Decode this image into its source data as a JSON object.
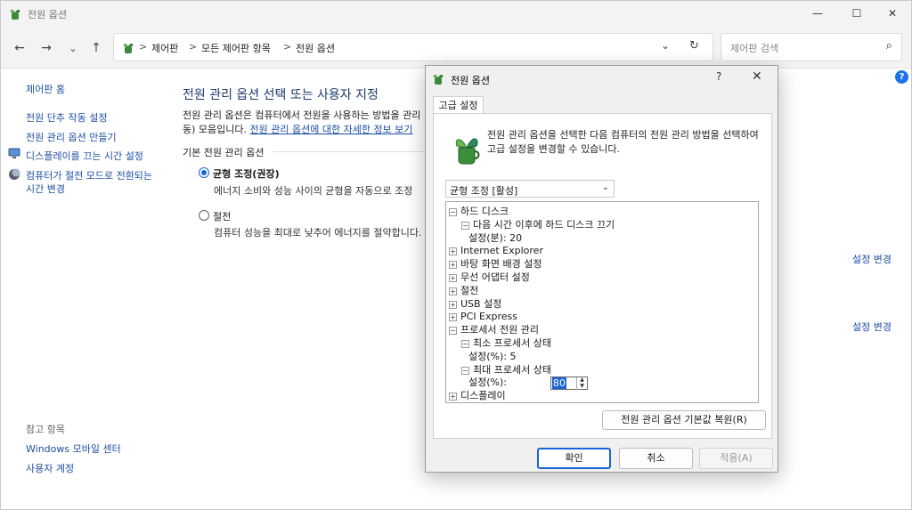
{
  "window": {
    "title": "전원 옵션",
    "controls": {
      "minimize": "—",
      "maximize": "☐",
      "close": "✕"
    }
  },
  "nav": {
    "back": "←",
    "forward": "→",
    "recent": "⌄",
    "up": "↑",
    "breadcrumb": [
      "제어판",
      "모든 제어판 항목",
      "전원 옵션"
    ],
    "separator": ">",
    "dropdown": "⌄",
    "refresh": "↻",
    "search_placeholder": "제어판 검색",
    "search_icon": "⌕"
  },
  "left": {
    "home": "제어판 홈",
    "links": [
      "전원 단추 작동 설정",
      "전원 관리 옵션 만들기",
      "디스플레이를 끄는 시간 설정"
    ],
    "sleep_link_line1": "컴퓨터가 절전 모드로 전환되는",
    "sleep_link_line2": "시간 변경",
    "see_also": "참고 항목",
    "see_also_links": [
      "Windows 모바일 센터",
      "사용자 계정"
    ]
  },
  "main": {
    "title": "전원 관리 옵션 선택 또는 사용자 지정",
    "desc_line1": "전원 관리 옵션은 컴퓨터에서 전원을 사용하는 방법을 관리",
    "desc_line2_prefix": "동) 모음입니다. ",
    "desc_link": "전원 관리 옵션에 대한 자세한 정보 보기",
    "group_label": "기본 전원 관리 옵션",
    "plans": [
      {
        "name": "균형 조정(권장)",
        "desc": "에너지 소비와 성능 사이의 균형을 자동으로 조정",
        "selected": true,
        "change": "설정 변경"
      },
      {
        "name": "절전",
        "desc": "컴퓨터 성능을 최대로 낮추어 에너지를 절약합니다.",
        "selected": false,
        "change": "설정 변경"
      }
    ],
    "help": "?"
  },
  "dialog": {
    "title": "전원 옵션",
    "help": "?",
    "close": "✕",
    "tab": "고급 설정",
    "intro": "전원 관리 옵션을 선택한 다음 컴퓨터의 전원 관리 방법을 선택하여 고급 설정을 변경할 수 있습니다.",
    "plan_select": "균형 조정 [활성]",
    "plan_select_arrow": "⌄",
    "tree": [
      {
        "exp": "−",
        "label": "하드 디스크",
        "indent": 0
      },
      {
        "exp": "−",
        "label": "다음 시간 이후에 하드 디스크 끄기",
        "indent": 1
      },
      {
        "exp": "",
        "label": "설정(분): 20",
        "indent": 2
      },
      {
        "exp": "+",
        "label": "Internet Explorer",
        "indent": 0
      },
      {
        "exp": "+",
        "label": "바탕 화면 배경 설정",
        "indent": 0
      },
      {
        "exp": "+",
        "label": "무선 어댑터 설정",
        "indent": 0
      },
      {
        "exp": "+",
        "label": "절전",
        "indent": 0
      },
      {
        "exp": "+",
        "label": "USB 설정",
        "indent": 0
      },
      {
        "exp": "+",
        "label": "PCI Express",
        "indent": 0
      },
      {
        "exp": "−",
        "label": "프로세서 전원 관리",
        "indent": 0
      },
      {
        "exp": "−",
        "label": "최소 프로세서 상태",
        "indent": 1
      },
      {
        "exp": "",
        "label": "설정(%): 5",
        "indent": 2
      },
      {
        "exp": "−",
        "label": "최대 프로세서 상태",
        "indent": 1
      },
      {
        "exp": "",
        "label": "설정(%):",
        "indent": 2,
        "spinner": "80"
      },
      {
        "exp": "+",
        "label": "디스플레이",
        "indent": 0
      }
    ],
    "restore": "전원 관리 옵션 기본값 복원(R)",
    "ok": "확인",
    "cancel": "취소",
    "apply": "적용(A)"
  },
  "colors": {
    "accent": "#1a63d6",
    "link": "#1d4fa3",
    "title_blue": "#1d3a6e"
  },
  "icons": [
    "power-plant-icon",
    "search-icon",
    "help-icon",
    "monitor-icon",
    "moon-icon"
  ]
}
